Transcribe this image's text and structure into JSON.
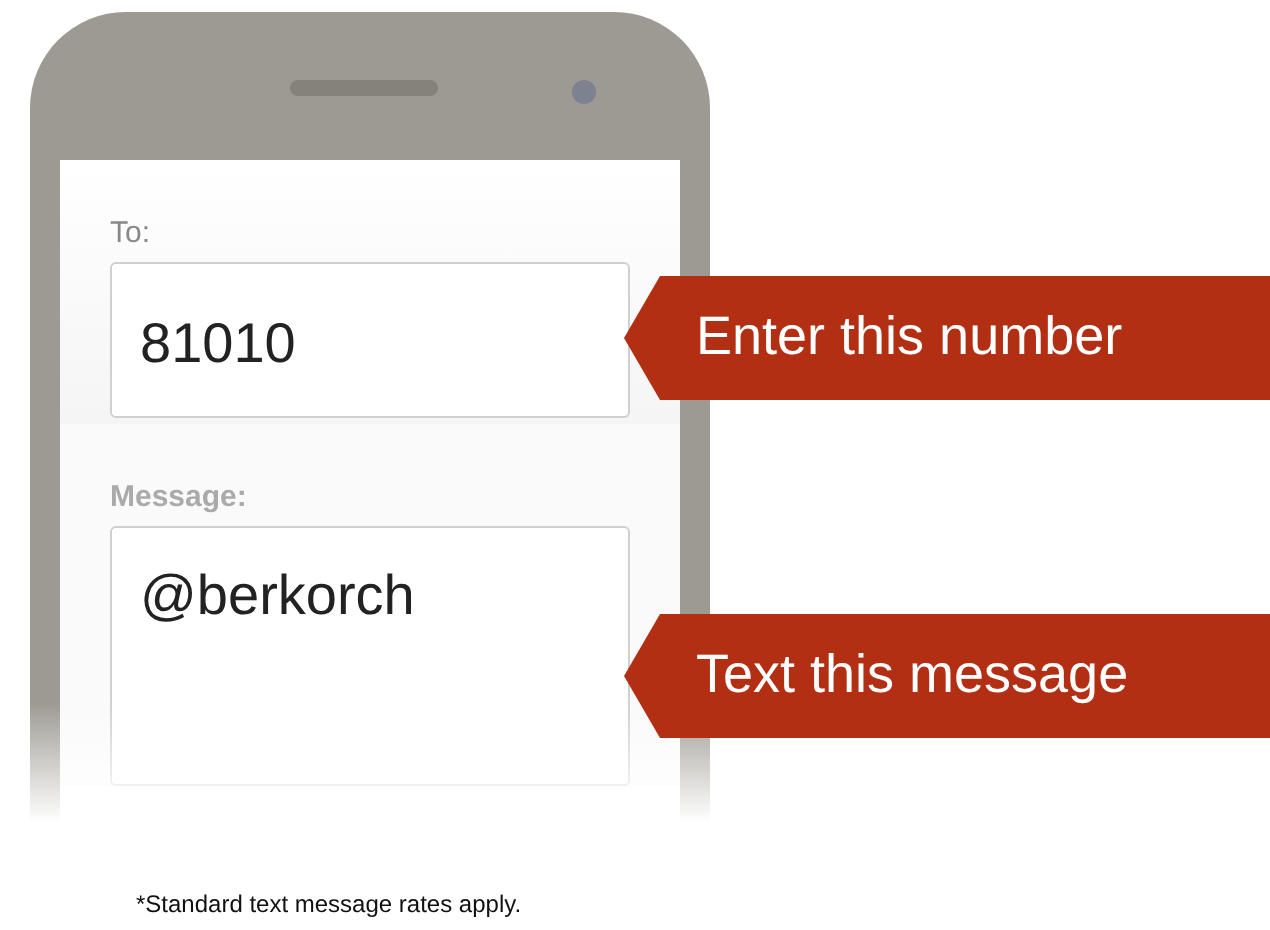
{
  "form": {
    "to_label": "To:",
    "to_value": "81010",
    "message_label": "Message:",
    "message_value": "@berkorch"
  },
  "callouts": [
    {
      "text": "Enter this number"
    },
    {
      "text": "Text this message"
    }
  ],
  "footnote": "*Standard text message rates apply."
}
